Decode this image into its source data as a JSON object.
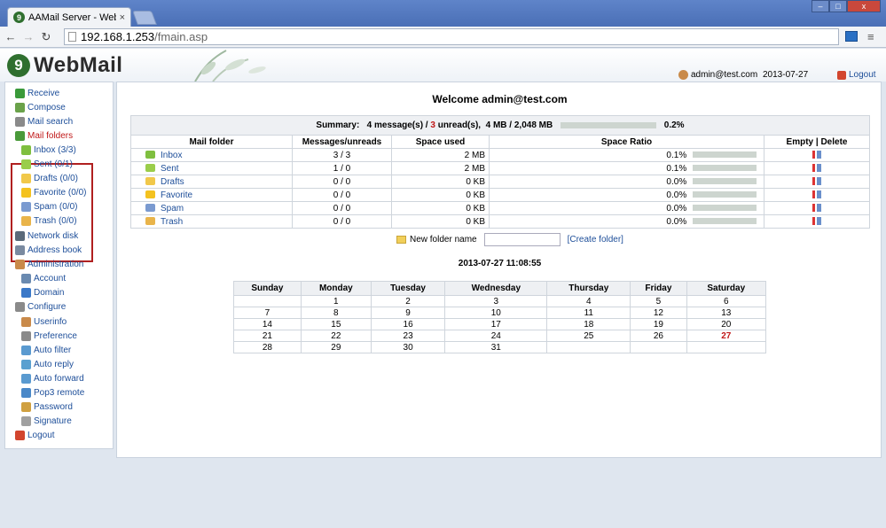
{
  "browser": {
    "tab_title": "AAMail Server - Webma",
    "tab_close": "×",
    "url_host": "192.168.1.253",
    "url_path": "/fmain.asp",
    "window_buttons": [
      "–",
      "□",
      "x"
    ]
  },
  "header": {
    "logo_text": "WebMail",
    "user": "admin@test.com",
    "date": "2013-07-27",
    "logout": "Logout"
  },
  "sidebar": {
    "items": [
      {
        "label": "Receive",
        "icon": "receive-icon"
      },
      {
        "label": "Compose",
        "icon": "compose-icon"
      },
      {
        "label": "Mail search",
        "icon": "search-icon"
      },
      {
        "label": "Mail folders",
        "icon": "home-icon"
      },
      {
        "label": "Inbox (3/3)",
        "icon": "inbox-icon"
      },
      {
        "label": "Sent (0/1)",
        "icon": "sent-icon"
      },
      {
        "label": "Drafts (0/0)",
        "icon": "drafts-icon"
      },
      {
        "label": "Favorite (0/0)",
        "icon": "star-icon"
      },
      {
        "label": "Spam (0/0)",
        "icon": "spam-icon"
      },
      {
        "label": "Trash (0/0)",
        "icon": "trash-icon"
      },
      {
        "label": "Network disk",
        "icon": "disk-icon"
      },
      {
        "label": "Address book",
        "icon": "addressbook-icon"
      },
      {
        "label": "Administration",
        "icon": "admin-icon"
      },
      {
        "label": "Account",
        "icon": "account-icon"
      },
      {
        "label": "Domain",
        "icon": "globe-icon"
      },
      {
        "label": "Configure",
        "icon": "tools-icon"
      },
      {
        "label": "Userinfo",
        "icon": "user-icon"
      },
      {
        "label": "Preference",
        "icon": "gear-icon"
      },
      {
        "label": "Auto filter",
        "icon": "filter-icon"
      },
      {
        "label": "Auto reply",
        "icon": "reply-icon"
      },
      {
        "label": "Auto forward",
        "icon": "forward-icon"
      },
      {
        "label": "Pop3 remote",
        "icon": "pop3-icon"
      },
      {
        "label": "Password",
        "icon": "lock-icon"
      },
      {
        "label": "Signature",
        "icon": "signature-icon"
      },
      {
        "label": "Logout",
        "icon": "logout-icon"
      }
    ]
  },
  "main": {
    "welcome": "Welcome admin@test.com",
    "summary": {
      "label": "Summary:",
      "messages": "4 message(s) /",
      "unread_count": "3",
      "unread_text": "unread(s),",
      "space": "4 MB / 2,048 MB",
      "percent": "0.2%"
    },
    "columns": [
      "Mail folder",
      "Messages/unreads",
      "Space used",
      "Space Ratio",
      "Empty | Delete"
    ],
    "folders": [
      {
        "name": "Inbox",
        "msgs": "3 / 3",
        "space": "2 MB",
        "ratio": "0.1%",
        "icon": "inbox-icon"
      },
      {
        "name": "Sent",
        "msgs": "1 / 0",
        "space": "2 MB",
        "ratio": "0.1%",
        "icon": "sent-icon"
      },
      {
        "name": "Drafts",
        "msgs": "0 / 0",
        "space": "0 KB",
        "ratio": "0.0%",
        "icon": "drafts-icon"
      },
      {
        "name": "Favorite",
        "msgs": "0 / 0",
        "space": "0 KB",
        "ratio": "0.0%",
        "icon": "star-icon"
      },
      {
        "name": "Spam",
        "msgs": "0 / 0",
        "space": "0 KB",
        "ratio": "0.0%",
        "icon": "spam-icon"
      },
      {
        "name": "Trash",
        "msgs": "0 / 0",
        "space": "0 KB",
        "ratio": "0.0%",
        "icon": "trash-icon"
      }
    ],
    "new_folder_label": "New folder name",
    "new_folder_value": "",
    "create_folder": "[Create folder]",
    "datetime": "2013-07-27 11:08:55"
  },
  "calendar": {
    "days": [
      "Sunday",
      "Monday",
      "Tuesday",
      "Wednesday",
      "Thursday",
      "Friday",
      "Saturday"
    ],
    "weeks": [
      [
        "",
        "1",
        "2",
        "3",
        "4",
        "5",
        "6"
      ],
      [
        "7",
        "8",
        "9",
        "10",
        "11",
        "12",
        "13"
      ],
      [
        "14",
        "15",
        "16",
        "17",
        "18",
        "19",
        "20"
      ],
      [
        "21",
        "22",
        "23",
        "24",
        "25",
        "26",
        "27"
      ],
      [
        "28",
        "29",
        "30",
        "31",
        "",
        "",
        ""
      ]
    ],
    "today": "27"
  },
  "colors": {
    "link": "#1d4e99",
    "highlight": "#c01818",
    "bar": "#cdd5cf"
  }
}
